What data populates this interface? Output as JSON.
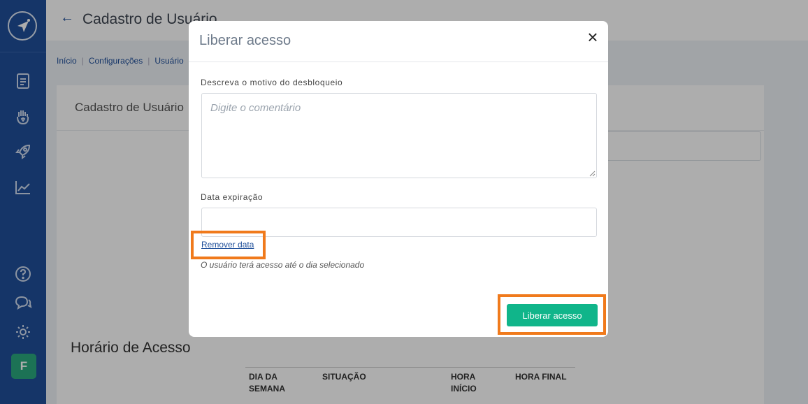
{
  "app": {
    "page_title": "Cadastro de Usuário",
    "breadcrumbs": [
      "Início",
      "Configurações",
      "Usuário"
    ],
    "card_title": "Cadastro de Usuário",
    "access_section_title": "Horário de Acesso",
    "table_headers": [
      "DIA DA SEMANA",
      "SITUAÇÃO",
      "HORA INÍCIO",
      "HORA FINAL"
    ],
    "avatar_letter": "F"
  },
  "modal": {
    "title": "Liberar acesso",
    "close_glyph": "×",
    "reason_label": "Descreva o motivo do desbloqueio",
    "reason_placeholder": "Digite o comentário",
    "date_label": "Data expiração",
    "remove_date_label": "Remover data",
    "hint": "O usuário terá acesso até o dia selecionado",
    "submit_label": "Liberar acesso"
  },
  "colors": {
    "sidebar": "#1f4f9a",
    "primary_button": "#10b58a",
    "highlight": "#f07a1c",
    "avatar": "#2aa97e"
  },
  "icons": {
    "sidebar": [
      "navigation-logo-icon",
      "document-icon",
      "hand-heart-icon",
      "rocket-icon",
      "chart-icon",
      "help-icon",
      "chat-icon",
      "gear-icon"
    ]
  }
}
